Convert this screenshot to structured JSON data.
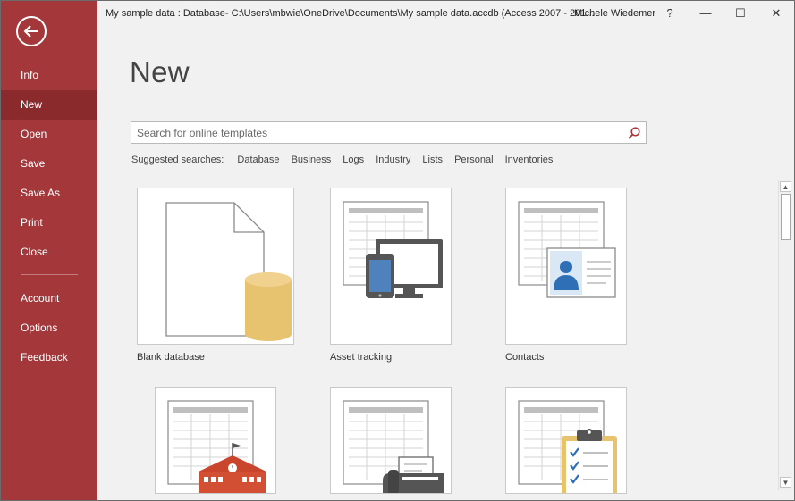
{
  "window": {
    "title": "My sample data : Database- C:\\Users\\mbwie\\OneDrive\\Documents\\My sample data.accdb (Access 2007 - 201...",
    "user": "Michele Wiedemer",
    "help_label": "?",
    "minimize_label": "—",
    "maximize_label": "☐",
    "close_label": "✕"
  },
  "sidebar": {
    "items": [
      {
        "label": "Info"
      },
      {
        "label": "New"
      },
      {
        "label": "Open"
      },
      {
        "label": "Save"
      },
      {
        "label": "Save As"
      },
      {
        "label": "Print"
      },
      {
        "label": "Close"
      },
      {
        "label": "Account"
      },
      {
        "label": "Options"
      },
      {
        "label": "Feedback"
      }
    ],
    "active": "New",
    "accent_color": "#a4373a"
  },
  "main": {
    "title": "New",
    "search": {
      "placeholder": "Search for online templates",
      "value": ""
    },
    "suggested": {
      "label": "Suggested searches:",
      "items": [
        "Database",
        "Business",
        "Logs",
        "Industry",
        "Lists",
        "Personal",
        "Inventories"
      ]
    },
    "templates": [
      {
        "label": "Blank database",
        "icon": "blank-database-icon"
      },
      {
        "label": "Asset tracking",
        "icon": "asset-tracking-icon"
      },
      {
        "label": "Contacts",
        "icon": "contacts-icon"
      },
      {
        "label": "",
        "icon": "school-icon"
      },
      {
        "label": "",
        "icon": "fax-icon"
      },
      {
        "label": "",
        "icon": "task-checklist-icon"
      }
    ]
  },
  "scrollbar": {
    "up_label": "▲",
    "down_label": "▼"
  }
}
